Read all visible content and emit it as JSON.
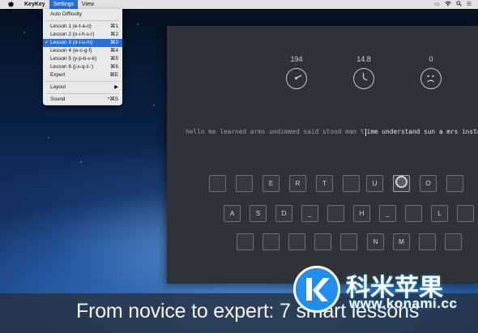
{
  "menubar": {
    "apple_icon": "apple-icon",
    "app_name": "KeyKey",
    "menus": [
      "Settings",
      "View"
    ],
    "status_icons": [
      "display-icon",
      "wifi-icon",
      "search-icon",
      "list-icon"
    ]
  },
  "settings_menu": {
    "items": [
      {
        "label": "Auto Difficulty",
        "shortcut": "",
        "checked": false
      },
      {
        "label": "Lesson 1 (e-t-a-o)",
        "shortcut": "⌘1",
        "checked": false
      },
      {
        "label": "Lesson 2 (n-i-h-s-r)",
        "shortcut": "⌘2",
        "checked": false
      },
      {
        "label": "Lesson 3 (d-l-u-m)",
        "shortcut": "⌘3",
        "checked": true
      },
      {
        "label": "Lesson 4 (w-c-g-f)",
        "shortcut": "⌘4",
        "checked": false
      },
      {
        "label": "Lesson 5 (y-p-b-v-k)",
        "shortcut": "⌘5",
        "checked": false
      },
      {
        "label": "Lesson 6 (j-x-q-z-')",
        "shortcut": "⌘6",
        "checked": false
      },
      {
        "label": "Expert",
        "shortcut": "⌘E",
        "checked": false
      },
      {
        "label": "Layout",
        "shortcut": "▶",
        "checked": false
      },
      {
        "label": "Sound",
        "shortcut": "^⌘S",
        "checked": false
      }
    ],
    "check_mark": "✓"
  },
  "stats": [
    {
      "value": "194",
      "icon": "speedometer-icon"
    },
    {
      "value": "14.8",
      "icon": "clock-icon"
    },
    {
      "value": "0",
      "icon": "sad-face-icon"
    }
  ],
  "sentence": {
    "typed": "hello me learned arms undimmed said stood man t",
    "remaining": "ime understand sun a mrs instead a"
  },
  "keyboard": {
    "row1": [
      "",
      "",
      "E",
      "R",
      "T",
      "",
      "U",
      "I",
      "",
      "O",
      ""
    ],
    "row2": [
      "A",
      "S",
      "D",
      "_",
      "",
      "H",
      "_",
      "",
      "L",
      ""
    ],
    "row3": [
      "",
      "",
      "",
      "",
      "",
      "N",
      "M",
      "",
      "",
      ""
    ]
  },
  "caption": "From novice to expert: 7 smart lessons",
  "watermark": {
    "chinese": "科米苹果",
    "url": "www.konami.cc"
  },
  "colors": {
    "menu_highlight": "#2a6fd6",
    "window_bg": "#2f3337",
    "watermark_blue": "#1f8ef0"
  }
}
